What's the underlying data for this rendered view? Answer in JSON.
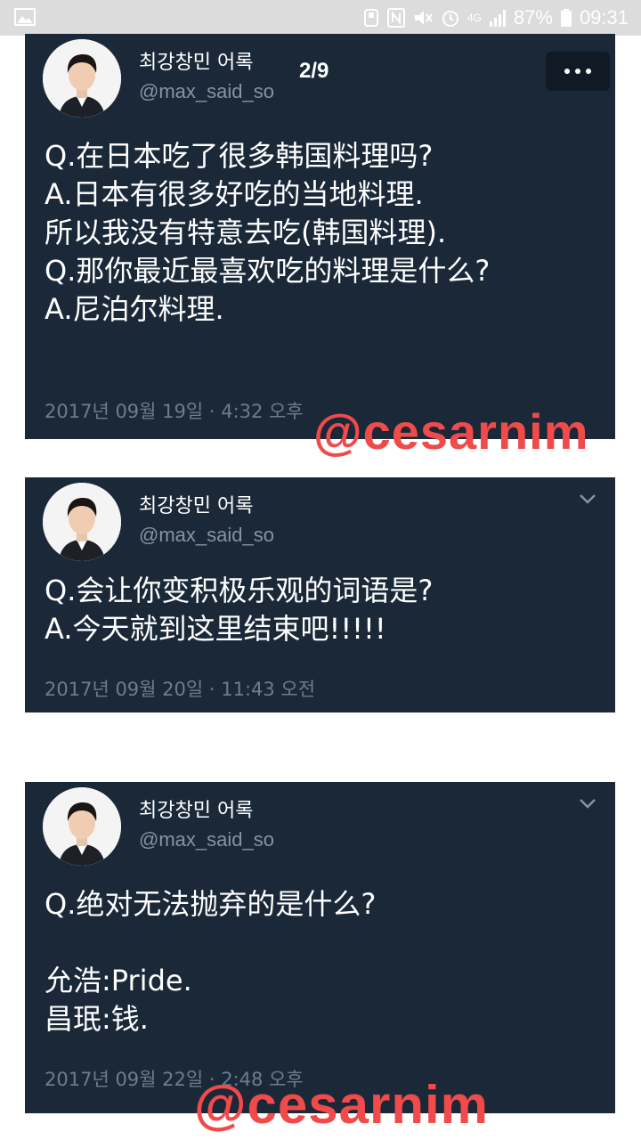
{
  "status_bar": {
    "battery": "87%",
    "time": "09:31",
    "network": "4G",
    "icons": [
      "gallery-icon",
      "nfc-icon",
      "mute-icon",
      "alarm-icon",
      "network-icon",
      "signal-icon",
      "battery-icon"
    ]
  },
  "viewer": {
    "page_counter": "2/9",
    "watermark": "@cesarnim"
  },
  "tweets": [
    {
      "display_name": "최강창민 어록",
      "handle": "@max_said_so",
      "lines": [
        "Q.在日本吃了很多韩国料理吗?",
        "A.日本有很多好吃的当地料理.",
        "所以我没有特意去吃(韩国料理).",
        "Q.那你最近最喜欢吃的料理是什么?",
        "A.尼泊尔料理."
      ],
      "timestamp": "2017년 09월 19일 · 4:32 오후"
    },
    {
      "display_name": "최강창민 어록",
      "handle": "@max_said_so",
      "lines": [
        "Q.会让你变积极乐观的词语是?",
        "A.今天就到这里结束吧!!!!!"
      ],
      "timestamp": "2017년 09월 20일 · 11:43 오전"
    },
    {
      "display_name": "최강창민 어록",
      "handle": "@max_said_so",
      "lines": [
        "Q.绝对无法抛弃的是什么?",
        "",
        "允浩:Pride.",
        "昌珉:钱."
      ],
      "timestamp": "2017년 09월 22일 · 2:48 오후"
    }
  ],
  "colors": {
    "card_bg": "#1a2838",
    "handle": "#8494a4",
    "timestamp": "#6d7d8c",
    "watermark": "#f04a4a"
  }
}
